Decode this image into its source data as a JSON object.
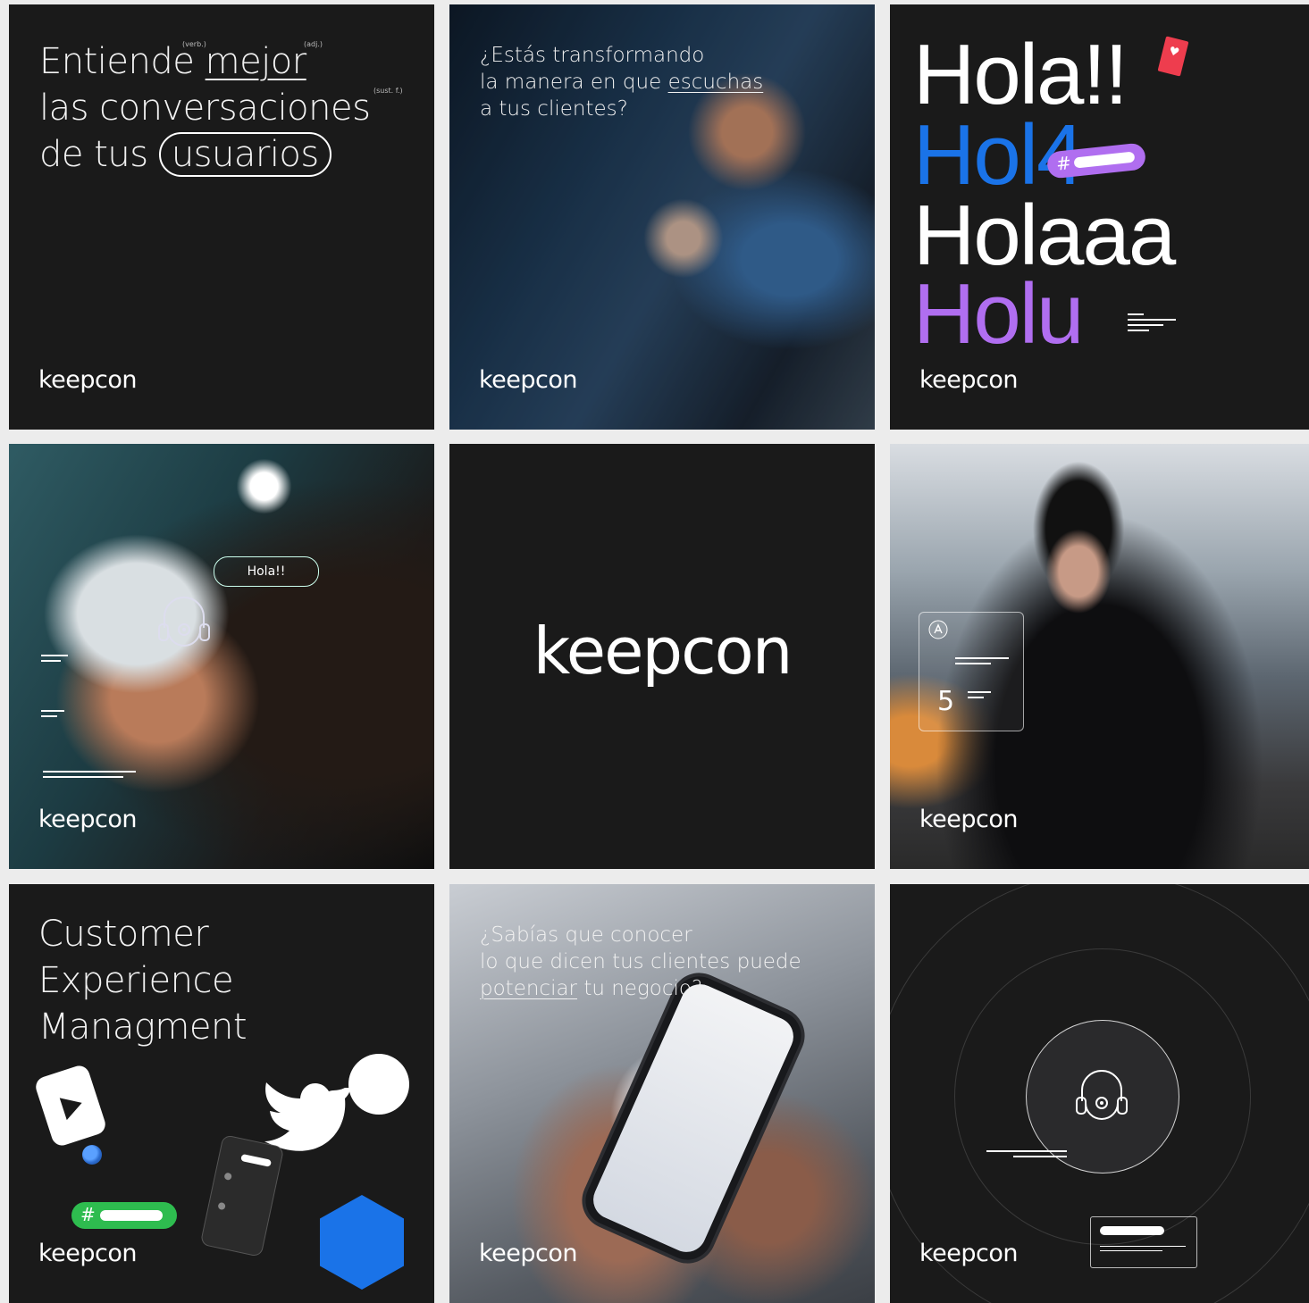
{
  "brand": "keepcon",
  "tile1": {
    "line1_a": "Entiende ",
    "line1_b": "mejor",
    "line2": "las conversaciones",
    "line3_a": "de tus ",
    "line3_b": "usuarios",
    "annot_verb": "(verb.)",
    "annot_adj": "(adj.)",
    "annot_sust": "(sust. f.)"
  },
  "tile2": {
    "line1": "¿Estás transformando",
    "line2_a": "la manera en que ",
    "line2_b": "escuchas",
    "line3": "a tus clientes?"
  },
  "tile3": {
    "hola1": "Hola!!",
    "hola2": "Hol4",
    "hola3": "Holaaa",
    "hola4": "Holu",
    "hash": "#",
    "colors": {
      "blue": "#1a73e8",
      "purple": "#b06ef0",
      "red": "#ee3d4e"
    }
  },
  "tile4": {
    "bubble": "Hola!!"
  },
  "tile6": {
    "metric": "5"
  },
  "tile7": {
    "line1": "Customer",
    "line2": "Experience",
    "line3": "Managment",
    "hash": "#",
    "colors": {
      "green": "#2ebc4f",
      "hex": "#1a73e8"
    }
  },
  "tile8": {
    "line1": "¿Sabías que conocer",
    "line2": "lo que dicen tus clientes puede",
    "line3_a": "potenciar",
    "line3_b": " tu negocio?"
  },
  "icons": [
    "heart-icon",
    "bot-headset-icon",
    "youtube-icon",
    "twitter-icon",
    "globe-icon",
    "hash-icon",
    "app-store-icon"
  ]
}
